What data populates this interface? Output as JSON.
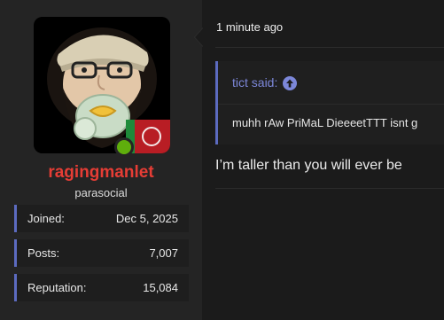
{
  "user": {
    "name": "ragingmanlet",
    "title": "parasocial",
    "online": true,
    "name_color": "#e63d35"
  },
  "stats": [
    {
      "label": "Joined:",
      "value": "Dec 5, 2025"
    },
    {
      "label": "Posts:",
      "value": "7,007"
    },
    {
      "label": "Reputation:",
      "value": "15,084"
    }
  ],
  "post": {
    "timestamp": "1 minute ago",
    "quote": {
      "author_line": "tict said:",
      "arrow_icon": "arrow-up-circle-icon",
      "text": "muhh rAw PriMaL DieeeetTTT isnt g"
    },
    "message": "I’m taller than you will ever be"
  },
  "colors": {
    "accent": "#5c6bc0",
    "quote_link": "#7c87d9",
    "online": "#5fae0c"
  }
}
